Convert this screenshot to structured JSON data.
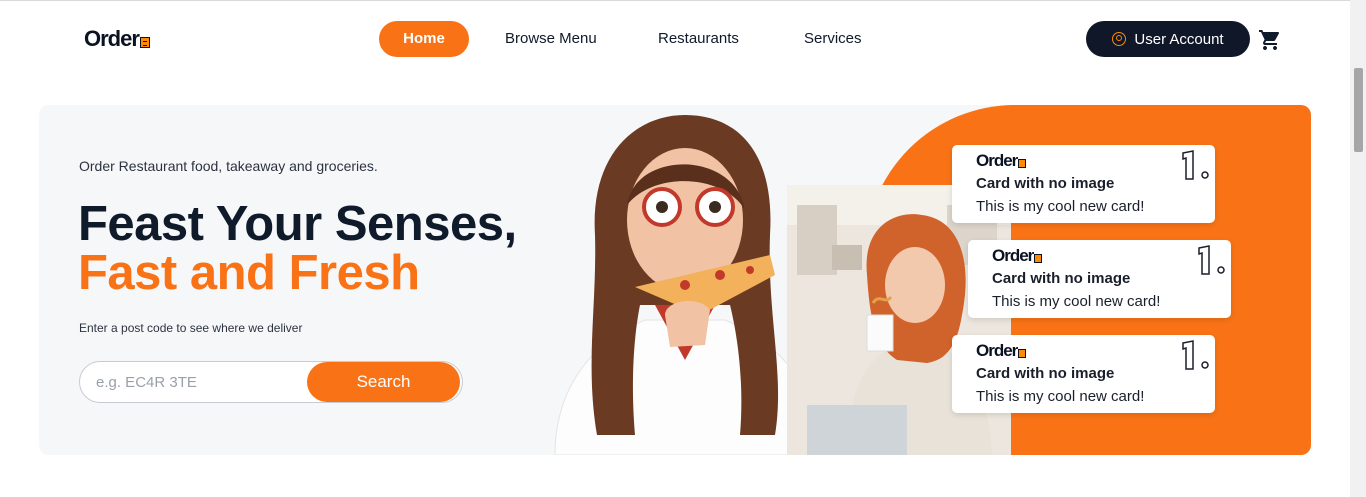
{
  "header": {
    "logo_text": "Order",
    "nav": [
      {
        "label": "Home",
        "active": true
      },
      {
        "label": "Browse Menu",
        "active": false
      },
      {
        "label": "Restaurants",
        "active": false
      },
      {
        "label": "Services",
        "active": false
      }
    ],
    "account_label": "User Account",
    "account_icon": "user-circle-icon",
    "cart_icon": "shopping-cart-icon"
  },
  "hero": {
    "tagline": "Order Restaurant food, takeaway and groceries.",
    "headline_line1": "Feast Your Senses,",
    "headline_line2": "Fast and Fresh",
    "postcode_label": "Enter a post code to see where we deliver",
    "search": {
      "placeholder": "e.g. EC4R 3TE",
      "value": "",
      "button_label": "Search"
    }
  },
  "cards": [
    {
      "logo_text": "Order",
      "title": "Card with no image",
      "text": "This is my cool new card!",
      "badge": "1"
    },
    {
      "logo_text": "Order",
      "title": "Card with no image",
      "text": "This is my cool new card!",
      "badge": "1"
    },
    {
      "logo_text": "Order",
      "title": "Card with no image",
      "text": "This is my cool new card!",
      "badge": "1"
    }
  ],
  "colors": {
    "accent": "#f97316",
    "dark": "#0f1729",
    "hero_bg": "#f6f7f9"
  }
}
